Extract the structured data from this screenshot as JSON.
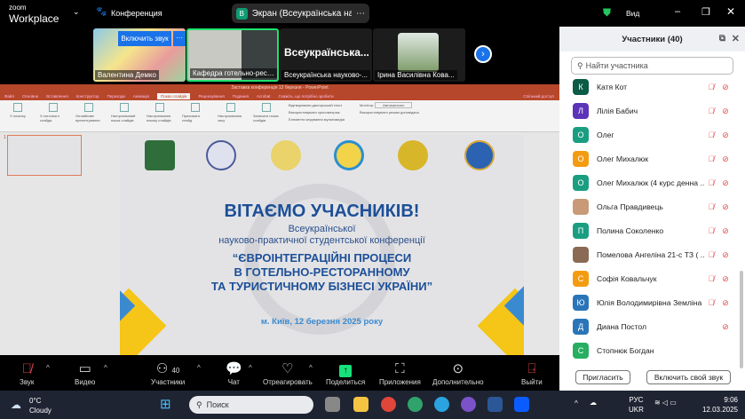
{
  "app": {
    "logo_top": "zoom",
    "logo_bottom": "Workplace",
    "meeting_label": "Конференция",
    "share_pill": "Экран (Всеукраїнська науково",
    "share_badge": "В",
    "view_label": "Вид"
  },
  "videos": [
    {
      "name": "Валентина Демко",
      "overlay_button": "Включить звук",
      "more": "···"
    },
    {
      "name": "Кафедра готельно-ресто..."
    },
    {
      "name": "Всеукраїнська науково-...",
      "big_label": "Всеукраїнська..."
    },
    {
      "name": "Ірина Василівна Кова..."
    }
  ],
  "ppt": {
    "title": "Заставка конференція 12 березня - PowerPoint",
    "tabs": [
      "Файл",
      "Основне",
      "Вставлення",
      "Конструктор",
      "Переходи",
      "Анімація",
      "Показ слайдів",
      "Рецензування",
      "Подання",
      "Acrobat",
      "Скажіть, що потрібно зробити"
    ],
    "share_button": "Спільний доступ",
    "ribbon": [
      "З початку",
      "З поточного слайда",
      "Онлайнове презентування",
      "Настроюваний показ слайдів",
      "Настроювання показу слайдів",
      "Приховати слайд",
      "Настроювання часу",
      "Записати показ слайдів"
    ],
    "checks": [
      "Відтворювати дикторський текст",
      "Використовувати хронометраж",
      "Елементи керування мультимедіа",
      "Використовувати режим доповідача"
    ],
    "monitor_label": "Монітор:",
    "monitor_value": "Автоматично",
    "groups": [
      "Розпочати показ слайдів",
      "Настроювання",
      "Монітори"
    ],
    "slide_number": "1"
  },
  "slide": {
    "heading": "ВІТАЄМО УЧАСНИКІВ!",
    "line1": "Всеукраїнської",
    "line2": "науково-практичної студентської конференції",
    "title1": "“ЄВРОІНТЕГРАЦІЙНІ ПРОЦЕСИ",
    "title2": "В ГОТЕЛЬНО-РЕСТОРАННОМУ",
    "title3": "ТА ТУРИСТИЧНОМУ БІЗНЕСІ УКРАЇНИ”",
    "place_date": "м. Київ, 12 березня 2025 року"
  },
  "participants": {
    "title": "Участники (40)",
    "search_placeholder": "Найти участника",
    "list": [
      {
        "initial": "К",
        "name": "Катя Кот",
        "color": "#0b5b45",
        "mic": true,
        "cam": true
      },
      {
        "initial": "Л",
        "name": "Лілія Бабич",
        "color": "#5b34b8",
        "mic": true,
        "cam": true
      },
      {
        "initial": "О",
        "name": "Олег",
        "color": "#1a9e82",
        "mic": true,
        "cam": true
      },
      {
        "initial": "О",
        "name": "Олег Михалюк",
        "color": "#f39c12",
        "mic": true,
        "cam": true
      },
      {
        "initial": "О",
        "name": "Олег Михалюк (4 курс денна ...",
        "color": "#1a9e82",
        "mic": true,
        "cam": true
      },
      {
        "initial": "",
        "name": "Ольга Правдивець",
        "color": "#c89a78",
        "mic": true,
        "cam": true
      },
      {
        "initial": "П",
        "name": "Полина Соколенко",
        "color": "#1a9e82",
        "mic": true,
        "cam": true
      },
      {
        "initial": "",
        "name": "Помелова Ангеліна 21-с ТЗ ( ...",
        "color": "#8a6a55",
        "mic": true,
        "cam": true
      },
      {
        "initial": "С",
        "name": "Софія Ковальчук",
        "color": "#f39c12",
        "mic": true,
        "cam": true
      },
      {
        "initial": "Ю",
        "name": "Юлія Володимирівна Земліна",
        "color": "#2a75b8",
        "mic": true,
        "cam": true
      },
      {
        "initial": "Д",
        "name": "Диана Постол",
        "color": "#2a75b8",
        "mic": false,
        "cam": true
      },
      {
        "initial": "С",
        "name": "Стопнюк Богдан",
        "color": "#27ae60",
        "mic": false,
        "cam": false
      }
    ],
    "invite": "Пригласить",
    "unmute": "Включить свой звук"
  },
  "toolbar": {
    "audio": "Звук",
    "video": "Видео",
    "participants": "Участники",
    "participants_count": "40",
    "chat": "Чат",
    "react": "Отреагировать",
    "share": "Поделиться",
    "apps": "Приложения",
    "more": "Дополнительно",
    "leave": "Выйти"
  },
  "taskbar": {
    "temp": "0°C",
    "weather": "Cloudy",
    "search": "Поиск",
    "lang1": "РУС",
    "lang2": "UKR",
    "time": "9:06",
    "date": "12.03.2025"
  }
}
